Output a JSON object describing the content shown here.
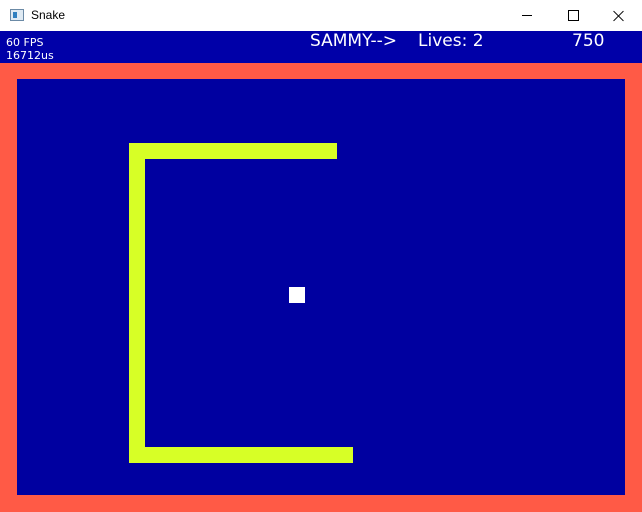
{
  "window": {
    "title": "Snake",
    "icon": "app-window-icon",
    "controls": [
      "minimize-icon",
      "maximize-icon",
      "close-icon"
    ]
  },
  "hud": {
    "fps": "60 FPS",
    "frame_time": "16712us",
    "player": "SAMMY-->",
    "lives": "Lives: 2",
    "score": "750"
  },
  "colors": {
    "hud_background": "#0000a8",
    "arena_background": "#0000a0",
    "wall": "#ff5a46",
    "snake": "#d7ff26",
    "food": "#ffffff",
    "text": "#ffffff"
  },
  "game": {
    "snake_segments": 4,
    "food_items": 1
  }
}
